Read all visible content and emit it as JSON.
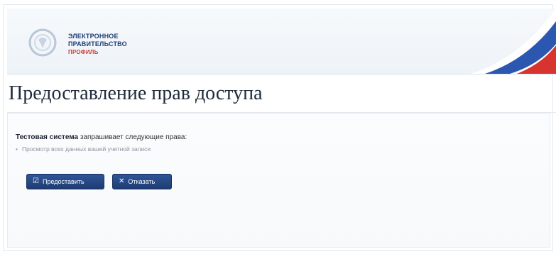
{
  "header": {
    "brand_line1": "ЭЛЕКТРОННОЕ",
    "brand_line2": "ПРАВИТЕЛЬСТВО",
    "brand_line3": "ПРОФИЛЬ",
    "logo_icon": "emblem-icon",
    "flag_colors": [
      "#ffffff",
      "#2b57b0",
      "#d7332f"
    ]
  },
  "page": {
    "title": "Предоставление прав доступа"
  },
  "request": {
    "system_name": "Тестовая система",
    "text": " запрашивает следующие права:",
    "permissions": [
      "Просмотр всех данных вашей учетной записи"
    ]
  },
  "buttons": {
    "grant_label": "Предоставить",
    "grant_icon": "check-icon",
    "deny_label": "Отказать",
    "deny_icon": "close-icon"
  },
  "colors": {
    "button_bg": "#1e3c72",
    "brand_blue": "#1f3e74",
    "brand_red": "#cc3b36"
  }
}
